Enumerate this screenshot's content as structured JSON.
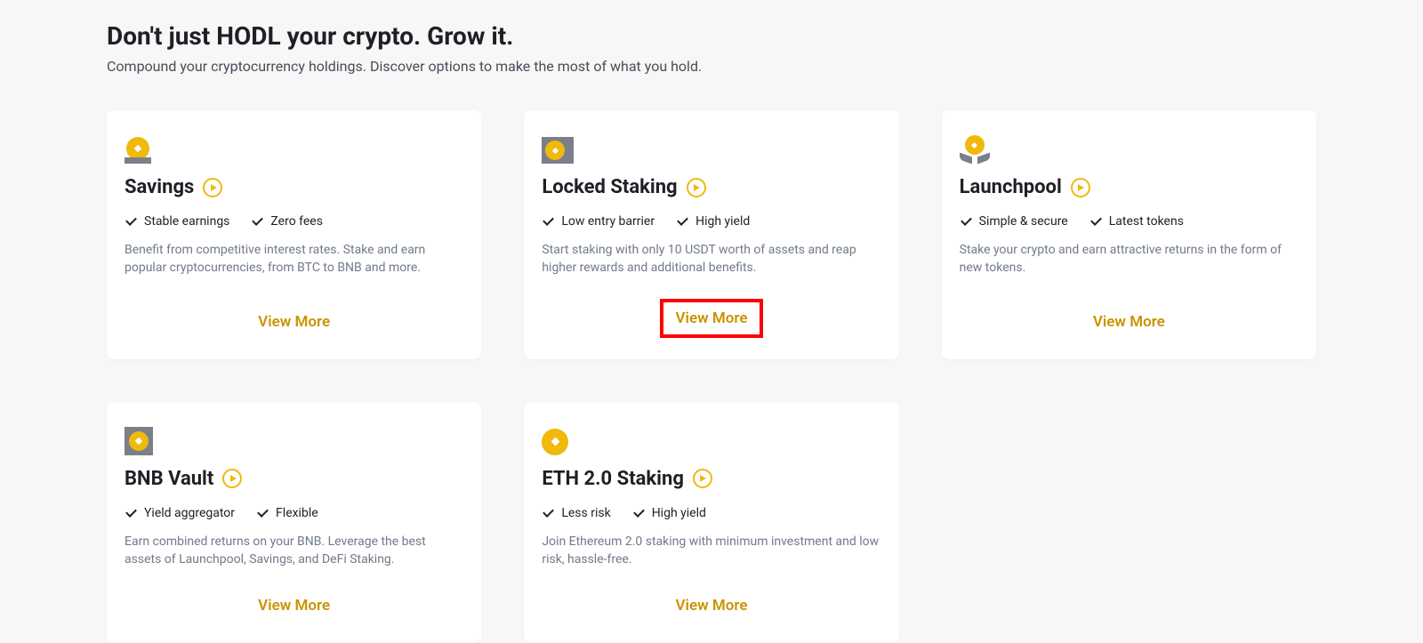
{
  "header": {
    "title": "Don't just HODL your crypto. Grow it.",
    "subtitle": "Compound your cryptocurrency holdings. Discover options to make the most of what you hold."
  },
  "common": {
    "view_more": "View More"
  },
  "cards": [
    {
      "id": "savings",
      "title": "Savings",
      "features": [
        "Stable earnings",
        "Zero fees"
      ],
      "description": "Benefit from competitive interest rates. Stake and earn popular cryptocurrencies, from BTC to BNB and more.",
      "highlighted": false
    },
    {
      "id": "locked-staking",
      "title": "Locked Staking",
      "features": [
        "Low entry barrier",
        "High yield"
      ],
      "description": "Start staking with only 10 USDT worth of assets and reap higher rewards and additional benefits.",
      "highlighted": true
    },
    {
      "id": "launchpool",
      "title": "Launchpool",
      "features": [
        "Simple & secure",
        "Latest tokens"
      ],
      "description": "Stake your crypto and earn attractive returns in the form of new tokens.",
      "highlighted": false
    },
    {
      "id": "bnb-vault",
      "title": "BNB Vault",
      "features": [
        "Yield aggregator",
        "Flexible"
      ],
      "description": "Earn combined returns on your BNB. Leverage the best assets of Launchpool, Savings, and DeFi Staking.",
      "highlighted": false
    },
    {
      "id": "eth-2-staking",
      "title": "ETH 2.0 Staking",
      "features": [
        "Less risk",
        "High yield"
      ],
      "description": "Join Ethereum 2.0 staking with minimum investment and low risk, hassle-free.",
      "highlighted": false
    }
  ]
}
